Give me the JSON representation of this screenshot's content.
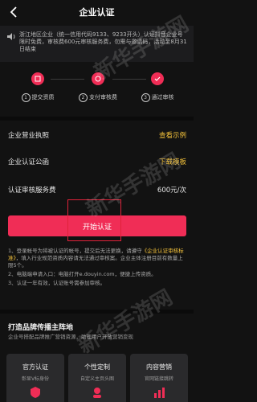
{
  "nav": {
    "title": "企业认证"
  },
  "notice": {
    "text": "浙江地区企业（统一信用代码9133、9233开头）认证抖音企业号限时免费，审核费600元审核服务费，勿需与邀请码，活动至8月31日结束"
  },
  "steps": [
    {
      "num": "1",
      "label": "提交资质"
    },
    {
      "num": "2",
      "label": "支付审核费"
    },
    {
      "num": "3",
      "label": "通过审核"
    }
  ],
  "rows": {
    "license": {
      "label": "企业营业执照",
      "action": "查看示例"
    },
    "letter": {
      "label": "企业认证公函",
      "action": "下载模板"
    },
    "fee": {
      "label": "认证审核服务费",
      "value": "600元/次"
    }
  },
  "start_button": {
    "label": "开始认证"
  },
  "notes": {
    "n1_pre": "1、登录帐号为将被认证的帐号，提交后无法更换，请遵守",
    "n1_link": "《企业认证审核标准》",
    "n1_post": "，填入行业规范资质内容请无法通过审核案。企业主体注册目前有数量上限5个。",
    "n2": "2、电脑端申请入口：电脑打开e.douyin.com，便捷上传资质。",
    "n3": "3、认证一年有效，认证账号需参加审核。"
  },
  "section": {
    "title": "打造品牌传播主阵地",
    "subtitle": "企业号搭配品牌推广营销资源，助理用户开放营销变现"
  },
  "cards": [
    {
      "title": "官方认证",
      "subtitle": "彰显V标身份"
    },
    {
      "title": "个性定制",
      "subtitle": "自定义主页头图"
    },
    {
      "title": "内容营销",
      "subtitle": "官网链接跳转"
    }
  ],
  "watermark": {
    "text": "新华手游网"
  },
  "colors": {
    "accent": "#f02d56",
    "link": "#f5c33b",
    "background": "#121212"
  }
}
